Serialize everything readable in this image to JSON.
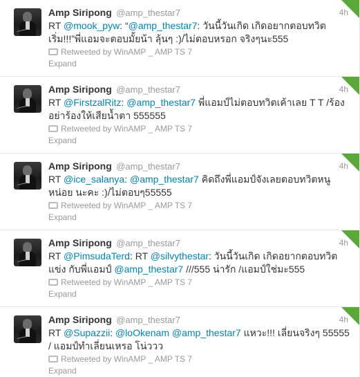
{
  "tweets": [
    {
      "fullname": "Amp Siripong",
      "username": "@amp_thestar7",
      "time": "4h",
      "parts": [
        {
          "t": "RT ",
          "m": false
        },
        {
          "t": "@mook_pyw",
          "m": true
        },
        {
          "t": ": “",
          "m": false
        },
        {
          "t": "@amp_thestar7",
          "m": true
        },
        {
          "t": ": วันนี้วันเกิด เกิดอยากตอบทวิต เริ่ม!!!”พี่แอมจะตอบมั้ยน้า ลุ้นๆ :)/ไม่ตอบหรอก จริงๆนะ555",
          "m": false
        }
      ],
      "retweeted_by": "Retweeted by WinAMP _ AMP TS 7",
      "expand": "Expand"
    },
    {
      "fullname": "Amp Siripong",
      "username": "@amp_thestar7",
      "time": "4h",
      "parts": [
        {
          "t": "RT ",
          "m": false
        },
        {
          "t": "@FirstzalRitz",
          "m": true
        },
        {
          "t": ": ",
          "m": false
        },
        {
          "t": "@amp_thestar7",
          "m": true
        },
        {
          "t": " พี่แอมป์ไม่ตอบทวิตเค้าเลย T T /ร้อง อย่าร้องให้เสียน้ำตา 555555",
          "m": false
        }
      ],
      "retweeted_by": "Retweeted by WinAMP _ AMP TS 7",
      "expand": "Expand"
    },
    {
      "fullname": "Amp Siripong",
      "username": "@amp_thestar7",
      "time": "4h",
      "parts": [
        {
          "t": "RT ",
          "m": false
        },
        {
          "t": "@ice_salanya",
          "m": true
        },
        {
          "t": ": ",
          "m": false
        },
        {
          "t": "@amp_thestar7",
          "m": true
        },
        {
          "t": " คิดถึงพี่แอมป์จังเลยตอบทวิตหนูหน่อย นะคะ :)/ไม่ตอบๆ55555",
          "m": false
        }
      ],
      "retweeted_by": "Retweeted by WinAMP _ AMP TS 7",
      "expand": "Expand"
    },
    {
      "fullname": "Amp Siripong",
      "username": "@amp_thestar7",
      "time": "4h",
      "parts": [
        {
          "t": "RT ",
          "m": false
        },
        {
          "t": "@PimsudaTerd",
          "m": true
        },
        {
          "t": ": RT ",
          "m": false
        },
        {
          "t": "@silvythestar",
          "m": true
        },
        {
          "t": ": วันนี้วันเกิด เกิดอยากตอบทวิตแข่ง กับพี่แอมป์ ",
          "m": false
        },
        {
          "t": "@amp_thestar7",
          "m": true
        },
        {
          "t": " ///555 น่ารัก /แอมป์ใช่มะ555",
          "m": false
        }
      ],
      "retweeted_by": "Retweeted by WinAMP _ AMP TS 7",
      "expand": "Expand"
    },
    {
      "fullname": "Amp Siripong",
      "username": "@amp_thestar7",
      "time": "4h",
      "parts": [
        {
          "t": "RT ",
          "m": false
        },
        {
          "t": "@Supazzii",
          "m": true
        },
        {
          "t": ": ",
          "m": false
        },
        {
          "t": "@loOkenam",
          "m": true
        },
        {
          "t": " ",
          "m": false
        },
        {
          "t": "@amp_thestar7",
          "m": true
        },
        {
          "t": " แหวะ!!! เลี่ยนจริงๆ 55555 / แอมป์ทำเลี่ยนเหรอ โน่ววว",
          "m": false
        }
      ],
      "retweeted_by": "Retweeted by WinAMP _ AMP TS 7",
      "expand": "Expand"
    }
  ],
  "icons": {
    "avatar": "profile-avatar",
    "retweet": "retweet-icon",
    "corner": "retweeted-corner-icon"
  },
  "colors": {
    "mention": "#0084b4",
    "corner": "#5aa73a",
    "meta": "#999999"
  }
}
